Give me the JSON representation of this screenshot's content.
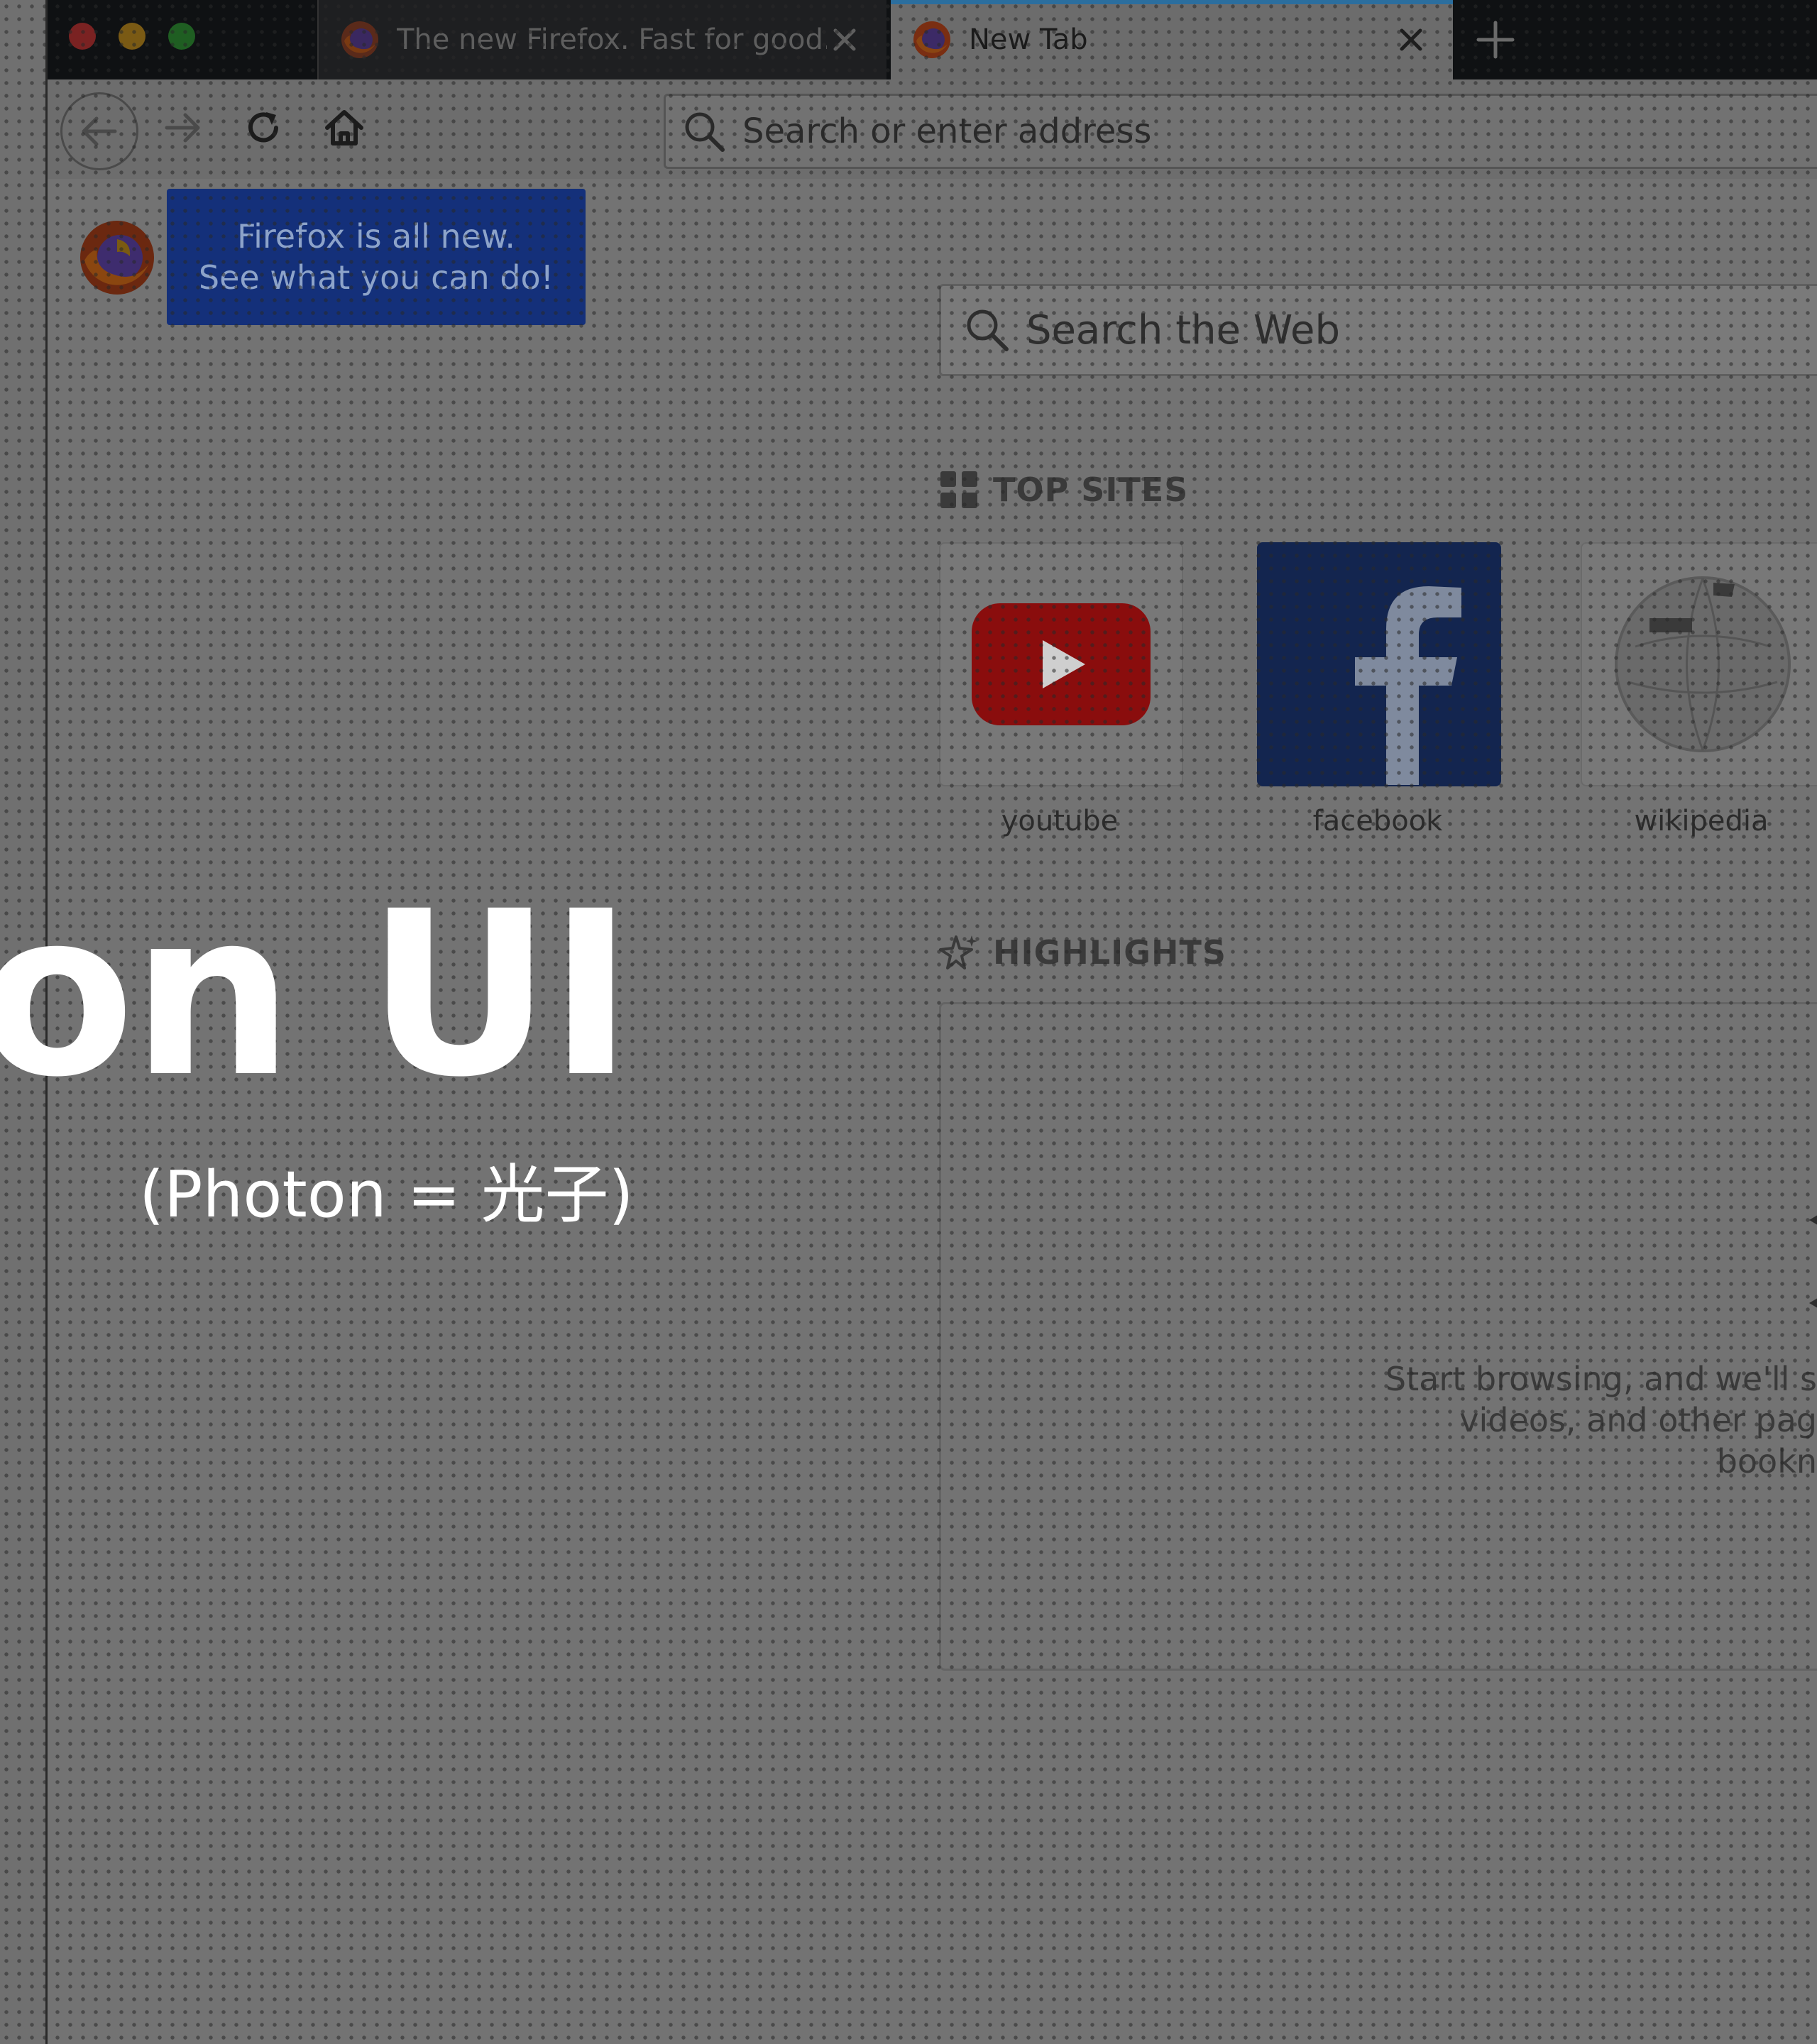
{
  "tabs": [
    {
      "title": "The new Firefox. Fast for good.",
      "active": false
    },
    {
      "title": "New Tab",
      "active": true
    }
  ],
  "toolbar": {
    "url_placeholder": "Search or enter address"
  },
  "callout": {
    "line1": "Firefox is all new.",
    "line2": "See what you can do!"
  },
  "web_search": {
    "placeholder": "Search the Web"
  },
  "top_sites": {
    "heading": "TOP SITES",
    "items": [
      {
        "name": "youtube",
        "icon": "youtube-icon"
      },
      {
        "name": "facebook",
        "icon": "facebook-icon"
      },
      {
        "name": "wikipedia",
        "icon": "wikipedia-icon"
      }
    ]
  },
  "highlights": {
    "heading": "HIGHLIGHTS",
    "empty_line1": "Start browsing, and we'll s",
    "empty_line2": "videos, and other pag",
    "empty_line3": "bookn"
  },
  "overlay": {
    "title": "on UI",
    "subtitle": "(Photon = 光子)"
  },
  "colors": {
    "callout_bg": "#14307a",
    "tab_accent": "#2b6e9e",
    "youtube_red": "#8a0d0d",
    "facebook_blue": "#13254f"
  }
}
